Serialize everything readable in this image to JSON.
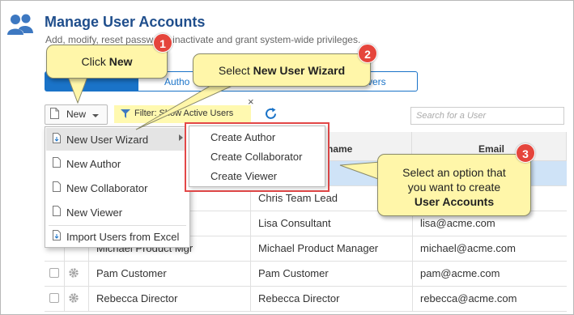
{
  "header": {
    "title": "Manage User Accounts",
    "subtitle": "Add, modify, reset password, inactivate and grant system-wide privileges."
  },
  "tabs": [
    {
      "label": ""
    },
    {
      "label": "Autho"
    },
    {
      "label": "vers"
    }
  ],
  "toolbar": {
    "new_label": "New",
    "filter_label": "Filter: Show Active Users",
    "filter_close": "×",
    "search_placeholder": "Search for a User"
  },
  "table": {
    "columns": [
      "",
      "",
      "",
      "name",
      "Email"
    ],
    "rows": [
      {
        "name": "",
        "display_name": "",
        "email": ""
      },
      {
        "name": "",
        "display_name": "Chris Team Lead",
        "email": ""
      },
      {
        "name": "",
        "display_name": "Lisa Consultant",
        "email": "lisa@acme.com"
      },
      {
        "name": "Michael Product Mgr",
        "display_name": "Michael Product Manager",
        "email": "michael@acme.com"
      },
      {
        "name": "Pam Customer",
        "display_name": "Pam Customer",
        "email": "pam@acme.com"
      },
      {
        "name": "Rebecca Director",
        "display_name": "Rebecca Director",
        "email": "rebecca@acme.com"
      }
    ]
  },
  "new_menu": {
    "items": [
      {
        "label": "New User Wizard"
      },
      {
        "label": "New Author"
      },
      {
        "label": "New Collaborator"
      },
      {
        "label": "New Viewer"
      },
      {
        "label": "Import Users from Excel"
      }
    ]
  },
  "submenu": {
    "items": [
      {
        "label": "Create Author"
      },
      {
        "label": "Create Collaborator"
      },
      {
        "label": "Create Viewer"
      }
    ]
  },
  "callouts": {
    "c1": {
      "number": "1",
      "prefix": "Click ",
      "bold": "New"
    },
    "c2": {
      "number": "2",
      "prefix": "Select ",
      "bold": "New User Wizard"
    },
    "c3": {
      "number": "3",
      "line1": "Select an option that",
      "line2": "you want to create",
      "bold": "User Accounts"
    }
  },
  "colors": {
    "accent": "#1a73c8",
    "title": "#1f4e8c",
    "callout_fill": "#fff6a9",
    "badge": "#e5453c",
    "highlight_box": "#e34848",
    "selected_row": "#cfe3f7",
    "filter_chip": "#fff9b0"
  }
}
